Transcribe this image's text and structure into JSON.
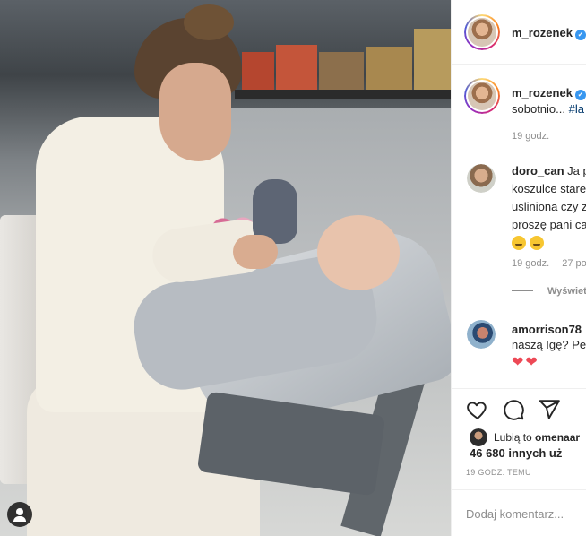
{
  "post": {
    "author": "m_rozenek",
    "caption": {
      "username": "m_rozenek",
      "text": "sobotnio... ",
      "hashtag": "#la",
      "time": "19 godz."
    },
    "comments": [
      {
        "username": "doro_can",
        "lines": [
          "Ja p",
          "koszulce stare",
          "usliniona czy z",
          "proszę pani ca"
        ],
        "time": "19 godz.",
        "likes": "27 po",
        "replies": "Wyświet"
      },
      {
        "username": "amorrison78",
        "lines": [
          "naszą Igę? Pev"
        ],
        "hearts": [
          "❤",
          "❤"
        ]
      }
    ],
    "likes": {
      "line1_prefix": "Lubią to ",
      "line1_user": "omenaar",
      "line2": "46 680 innych uż"
    },
    "posted": "19 GODZ. TEMU",
    "add_comment_placeholder": "Dodaj komentarz..."
  },
  "icons": {
    "verified": "verified-badge-icon",
    "like": "heart-outline-icon",
    "comment": "comment-bubble-icon",
    "share": "paper-plane-icon",
    "tag": "user-tag-icon"
  },
  "colors": {
    "verified": "#3897f0",
    "hashtag": "#00376b",
    "muted": "#8e8e8e",
    "heart": "#ed4956"
  }
}
